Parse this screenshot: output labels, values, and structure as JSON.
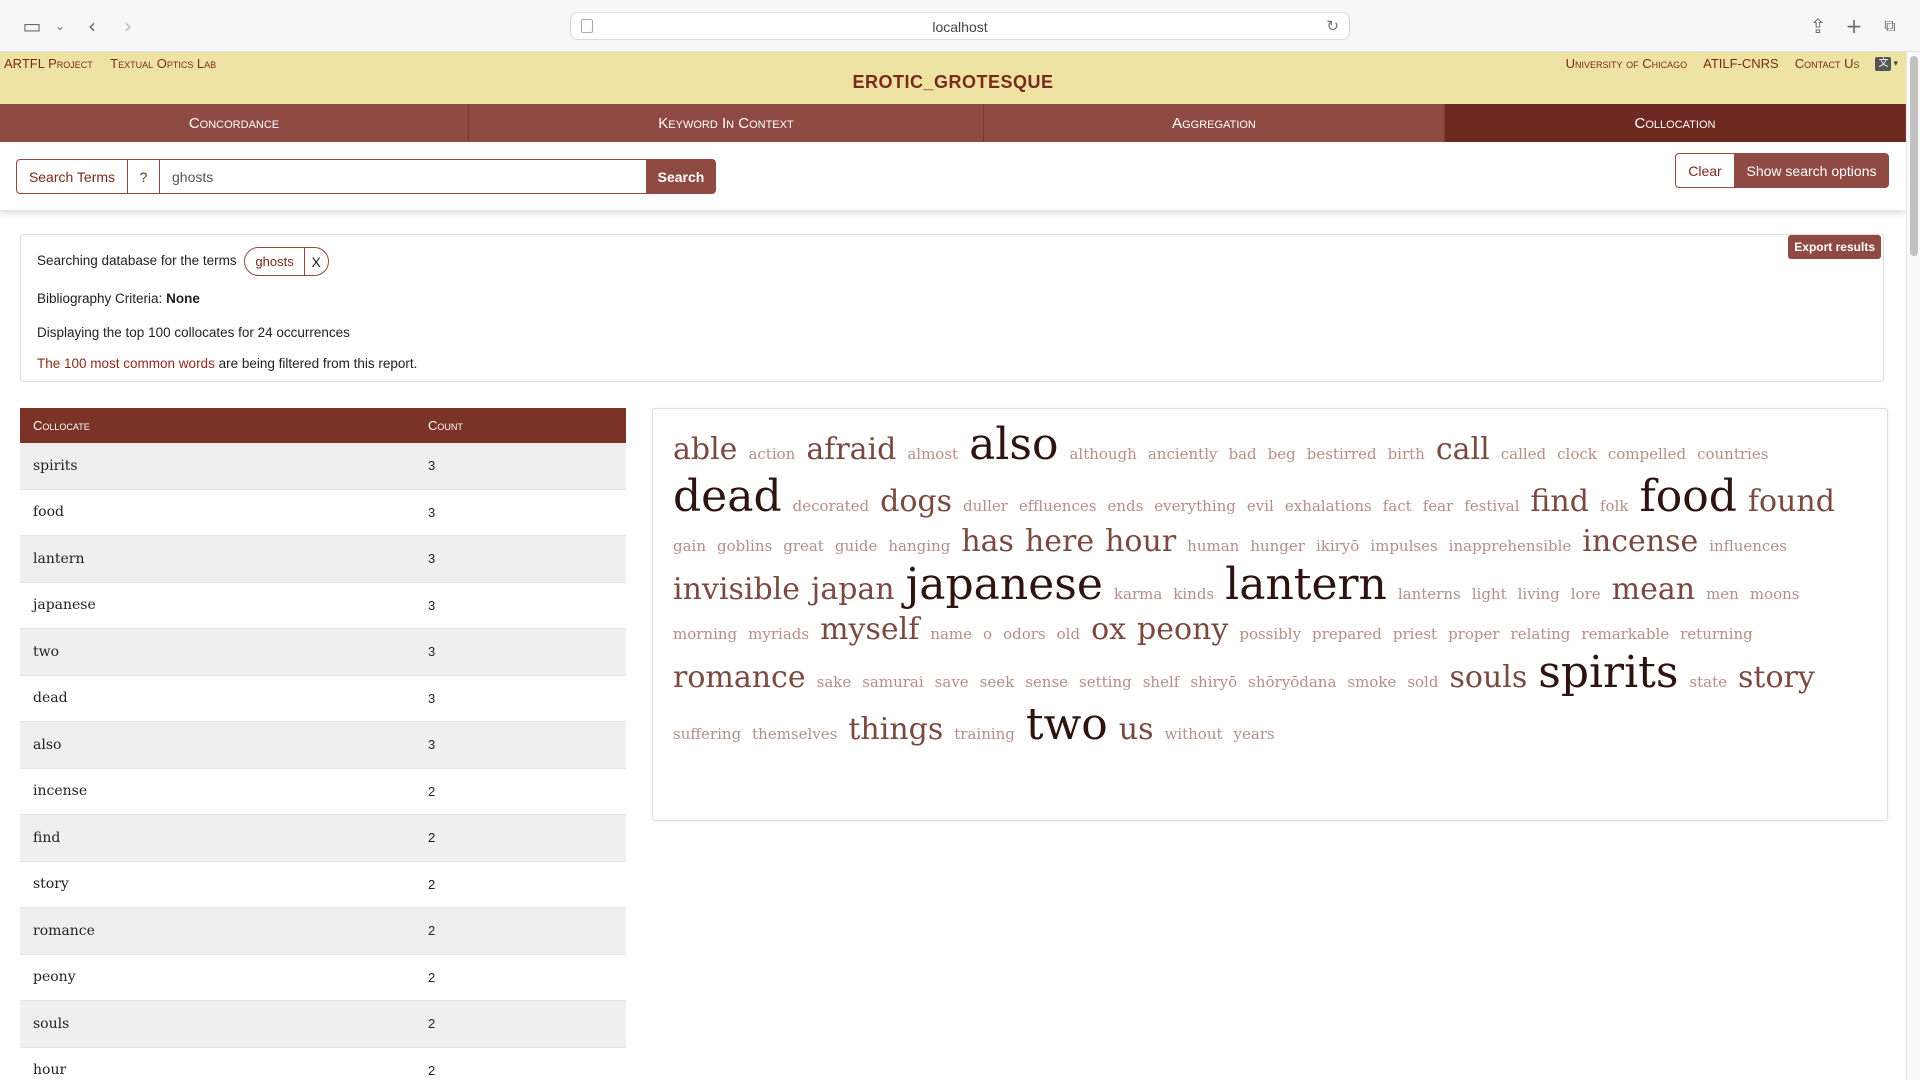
{
  "browser": {
    "url": "localhost"
  },
  "header": {
    "left_links": [
      "ARTFL Project",
      "Textual Optics Lab"
    ],
    "right_links": [
      "University of Chicago",
      "ATILF-CNRS",
      "Contact Us"
    ],
    "title": "EROTIC_GROTESQUE"
  },
  "tabs": [
    "Concordance",
    "Keyword In Context",
    "Aggregation",
    "Collocation"
  ],
  "active_tab": "Collocation",
  "search": {
    "terms_label": "Search Terms",
    "help_label": "?",
    "query": "ghosts",
    "search_label": "Search",
    "clear_label": "Clear",
    "options_label": "Show search options"
  },
  "info": {
    "searching_text": "Searching database for the terms",
    "term": "ghosts",
    "remove_label": "X",
    "biblio_label": "Bibliography Criteria:",
    "biblio_value": "None",
    "displaying": "Displaying the top 100 collocates for 24 occurrences",
    "filter_link": "The 100 most common words",
    "filter_rest": " are being filtered from this report.",
    "export_label": "Export results"
  },
  "table": {
    "headers": [
      "Collocate",
      "Count"
    ],
    "rows": [
      [
        "spirits",
        "3"
      ],
      [
        "food",
        "3"
      ],
      [
        "lantern",
        "3"
      ],
      [
        "japanese",
        "3"
      ],
      [
        "two",
        "3"
      ],
      [
        "dead",
        "3"
      ],
      [
        "also",
        "3"
      ],
      [
        "incense",
        "2"
      ],
      [
        "find",
        "2"
      ],
      [
        "story",
        "2"
      ],
      [
        "romance",
        "2"
      ],
      [
        "peony",
        "2"
      ],
      [
        "souls",
        "2"
      ],
      [
        "hour",
        "2"
      ]
    ]
  },
  "cloud_colors": {
    "c3": "#2e1410",
    "c2": "#7a4a40",
    "c1": "#b58f86"
  },
  "cloud": [
    {
      "w": "able",
      "c": 2
    },
    {
      "w": "action",
      "c": 1
    },
    {
      "w": "afraid",
      "c": 2
    },
    {
      "w": "almost",
      "c": 1
    },
    {
      "w": "also",
      "c": 3
    },
    {
      "w": "although",
      "c": 1
    },
    {
      "w": "anciently",
      "c": 1
    },
    {
      "w": "bad",
      "c": 1
    },
    {
      "w": "beg",
      "c": 1
    },
    {
      "w": "bestirred",
      "c": 1
    },
    {
      "w": "birth",
      "c": 1
    },
    {
      "w": "call",
      "c": 2
    },
    {
      "w": "called",
      "c": 1
    },
    {
      "w": "clock",
      "c": 1
    },
    {
      "w": "compelled",
      "c": 1
    },
    {
      "w": "countries",
      "c": 1
    },
    {
      "w": "dead",
      "c": 3
    },
    {
      "w": "decorated",
      "c": 1
    },
    {
      "w": "dogs",
      "c": 2
    },
    {
      "w": "duller",
      "c": 1
    },
    {
      "w": "effluences",
      "c": 1
    },
    {
      "w": "ends",
      "c": 1
    },
    {
      "w": "everything",
      "c": 1
    },
    {
      "w": "evil",
      "c": 1
    },
    {
      "w": "exhalations",
      "c": 1
    },
    {
      "w": "fact",
      "c": 1
    },
    {
      "w": "fear",
      "c": 1
    },
    {
      "w": "festival",
      "c": 1
    },
    {
      "w": "find",
      "c": 2
    },
    {
      "w": "folk",
      "c": 1
    },
    {
      "w": "food",
      "c": 3
    },
    {
      "w": "found",
      "c": 2
    },
    {
      "w": "gain",
      "c": 1
    },
    {
      "w": "goblins",
      "c": 1
    },
    {
      "w": "great",
      "c": 1
    },
    {
      "w": "guide",
      "c": 1
    },
    {
      "w": "hanging",
      "c": 1
    },
    {
      "w": "has",
      "c": 2
    },
    {
      "w": "here",
      "c": 2
    },
    {
      "w": "hour",
      "c": 2
    },
    {
      "w": "human",
      "c": 1
    },
    {
      "w": "hunger",
      "c": 1
    },
    {
      "w": "ikiryō",
      "c": 1
    },
    {
      "w": "impulses",
      "c": 1
    },
    {
      "w": "inapprehensible",
      "c": 1
    },
    {
      "w": "incense",
      "c": 2
    },
    {
      "w": "influences",
      "c": 1
    },
    {
      "w": "invisible",
      "c": 2
    },
    {
      "w": "japan",
      "c": 2
    },
    {
      "w": "japanese",
      "c": 3
    },
    {
      "w": "karma",
      "c": 1
    },
    {
      "w": "kinds",
      "c": 1
    },
    {
      "w": "lantern",
      "c": 3
    },
    {
      "w": "lanterns",
      "c": 1
    },
    {
      "w": "light",
      "c": 1
    },
    {
      "w": "living",
      "c": 1
    },
    {
      "w": "lore",
      "c": 1
    },
    {
      "w": "mean",
      "c": 2
    },
    {
      "w": "men",
      "c": 1
    },
    {
      "w": "moons",
      "c": 1
    },
    {
      "w": "morning",
      "c": 1
    },
    {
      "w": "myriads",
      "c": 1
    },
    {
      "w": "myself",
      "c": 2
    },
    {
      "w": "name",
      "c": 1
    },
    {
      "w": "o",
      "c": 1
    },
    {
      "w": "odors",
      "c": 1
    },
    {
      "w": "old",
      "c": 1
    },
    {
      "w": "ox",
      "c": 2
    },
    {
      "w": "peony",
      "c": 2
    },
    {
      "w": "possibly",
      "c": 1
    },
    {
      "w": "prepared",
      "c": 1
    },
    {
      "w": "priest",
      "c": 1
    },
    {
      "w": "proper",
      "c": 1
    },
    {
      "w": "relating",
      "c": 1
    },
    {
      "w": "remarkable",
      "c": 1
    },
    {
      "w": "returning",
      "c": 1
    },
    {
      "w": "romance",
      "c": 2
    },
    {
      "w": "sake",
      "c": 1
    },
    {
      "w": "samurai",
      "c": 1
    },
    {
      "w": "save",
      "c": 1
    },
    {
      "w": "seek",
      "c": 1
    },
    {
      "w": "sense",
      "c": 1
    },
    {
      "w": "setting",
      "c": 1
    },
    {
      "w": "shelf",
      "c": 1
    },
    {
      "w": "shiryō",
      "c": 1
    },
    {
      "w": "shōryōdana",
      "c": 1
    },
    {
      "w": "smoke",
      "c": 1
    },
    {
      "w": "sold",
      "c": 1
    },
    {
      "w": "souls",
      "c": 2
    },
    {
      "w": "spirits",
      "c": 3
    },
    {
      "w": "state",
      "c": 1
    },
    {
      "w": "story",
      "c": 2
    },
    {
      "w": "suffering",
      "c": 1
    },
    {
      "w": "themselves",
      "c": 1
    },
    {
      "w": "things",
      "c": 2
    },
    {
      "w": "training",
      "c": 1
    },
    {
      "w": "two",
      "c": 3
    },
    {
      "w": "us",
      "c": 2
    },
    {
      "w": "without",
      "c": 1
    },
    {
      "w": "years",
      "c": 1
    }
  ]
}
